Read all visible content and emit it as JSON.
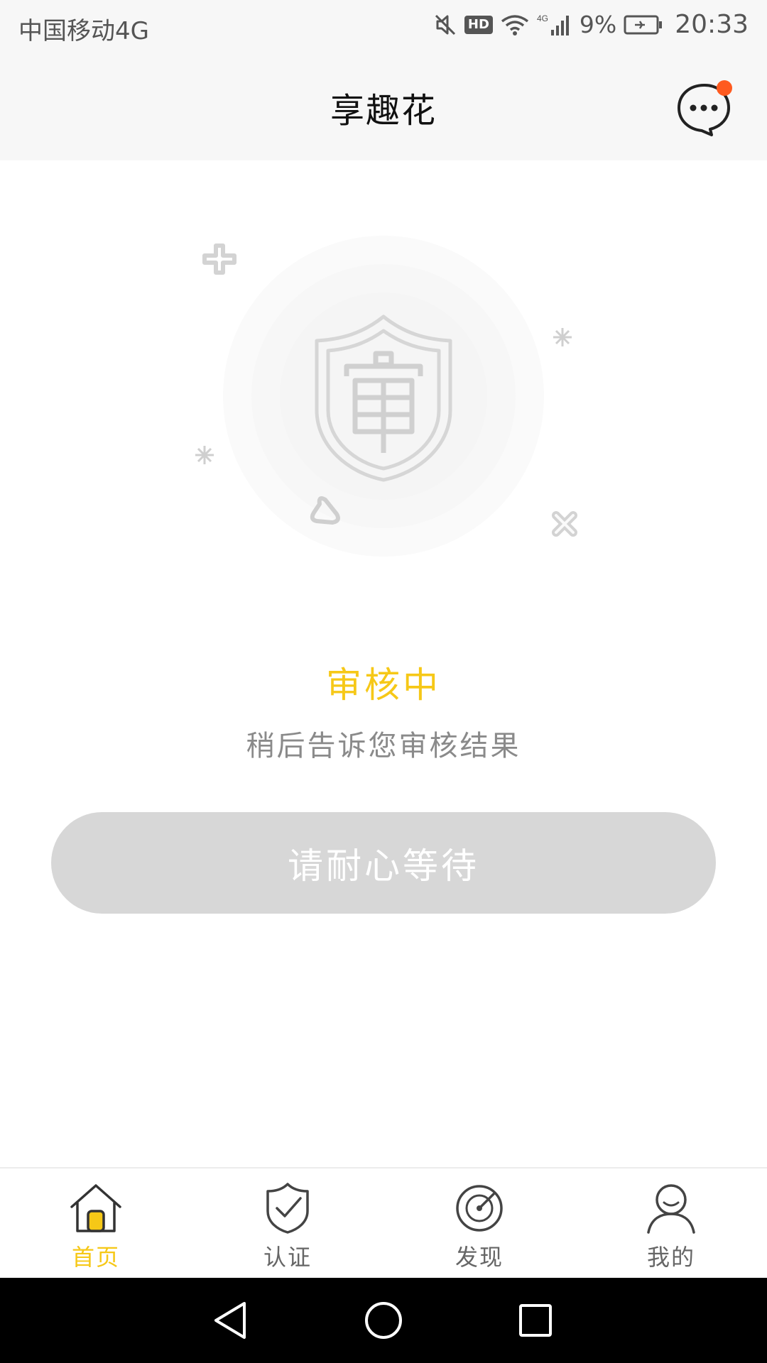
{
  "status_bar": {
    "carrier": "中国移动4G",
    "hd": "HD",
    "network": "4G",
    "battery": "9%",
    "time": "20:33",
    "icons": [
      "mute-icon",
      "hd-icon",
      "wifi-icon",
      "signal-icon",
      "battery-charging-icon"
    ]
  },
  "header": {
    "title": "享趣花",
    "message_icon": "chat-bubble-icon",
    "has_unread": true
  },
  "review": {
    "illustration": "shield-review-icon",
    "status": "审核中",
    "description": "稍后告诉您审核结果",
    "button_label": "请耐心等待"
  },
  "tabs": [
    {
      "label": "首页",
      "icon": "home-icon",
      "active": true
    },
    {
      "label": "认证",
      "icon": "shield-check-icon",
      "active": false
    },
    {
      "label": "发现",
      "icon": "compass-icon",
      "active": false
    },
    {
      "label": "我的",
      "icon": "user-icon",
      "active": false
    }
  ],
  "system_nav": [
    "back-icon",
    "home-circle-icon",
    "recents-icon"
  ],
  "colors": {
    "accent": "#f6c817",
    "badge": "#ff5a1f",
    "button_disabled": "#d7d7d7",
    "header_bg": "#f7f7f7"
  }
}
